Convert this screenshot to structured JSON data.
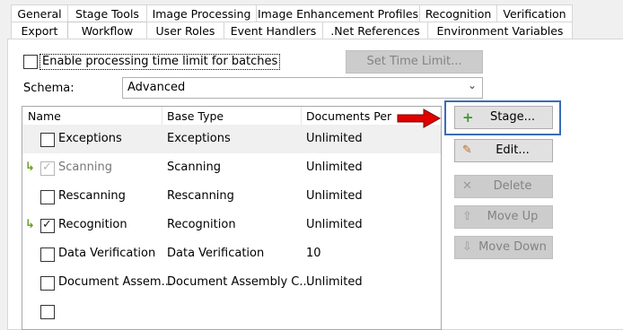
{
  "tabs_row1": [
    {
      "label": "General"
    },
    {
      "label": "Stage Tools"
    },
    {
      "label": "Image Processing"
    },
    {
      "label": "Image Enhancement Profiles"
    },
    {
      "label": "Recognition"
    },
    {
      "label": "Verification"
    }
  ],
  "tabs_row2": [
    {
      "label": "Export"
    },
    {
      "label": "Workflow",
      "active": true
    },
    {
      "label": "User Roles"
    },
    {
      "label": "Event Handlers"
    },
    {
      "label": ".Net References"
    },
    {
      "label": "Environment Variables"
    }
  ],
  "time_limit": {
    "checkbox_label": "Enable processing time limit for batches",
    "checked": false,
    "set_button": "Set Time Limit..."
  },
  "schema": {
    "label": "Schema:",
    "value": "Advanced"
  },
  "stages_table": {
    "columns": [
      "Name",
      "Base Type",
      "Documents Per Task"
    ],
    "rows": [
      {
        "name": "Exceptions",
        "base_type": "Exceptions",
        "docs": "Unlimited",
        "checked": false,
        "arrow": false,
        "enabled": true
      },
      {
        "name": "Scanning",
        "base_type": "Scanning",
        "docs": "Unlimited",
        "checked": true,
        "arrow": true,
        "enabled": false
      },
      {
        "name": "Rescanning",
        "base_type": "Rescanning",
        "docs": "Unlimited",
        "checked": false,
        "arrow": false,
        "enabled": true
      },
      {
        "name": "Recognition",
        "base_type": "Recognition",
        "docs": "Unlimited",
        "checked": true,
        "arrow": true,
        "enabled": true
      },
      {
        "name": "Data Verification",
        "base_type": "Data Verification",
        "docs": "10",
        "checked": false,
        "arrow": false,
        "enabled": true
      },
      {
        "name": "Document Assem...",
        "base_type": "Document Assembly C...",
        "docs": "Unlimited",
        "checked": false,
        "arrow": false,
        "enabled": true
      }
    ]
  },
  "buttons": {
    "stage": "Stage...",
    "edit": "Edit...",
    "delete": "Delete",
    "move_up": "Move Up",
    "move_down": "Move Down"
  },
  "colors": {
    "highlight_box": "#3a6db5",
    "annotation_arrow": "#e00000",
    "plus_icon": "#3a9a2e"
  }
}
